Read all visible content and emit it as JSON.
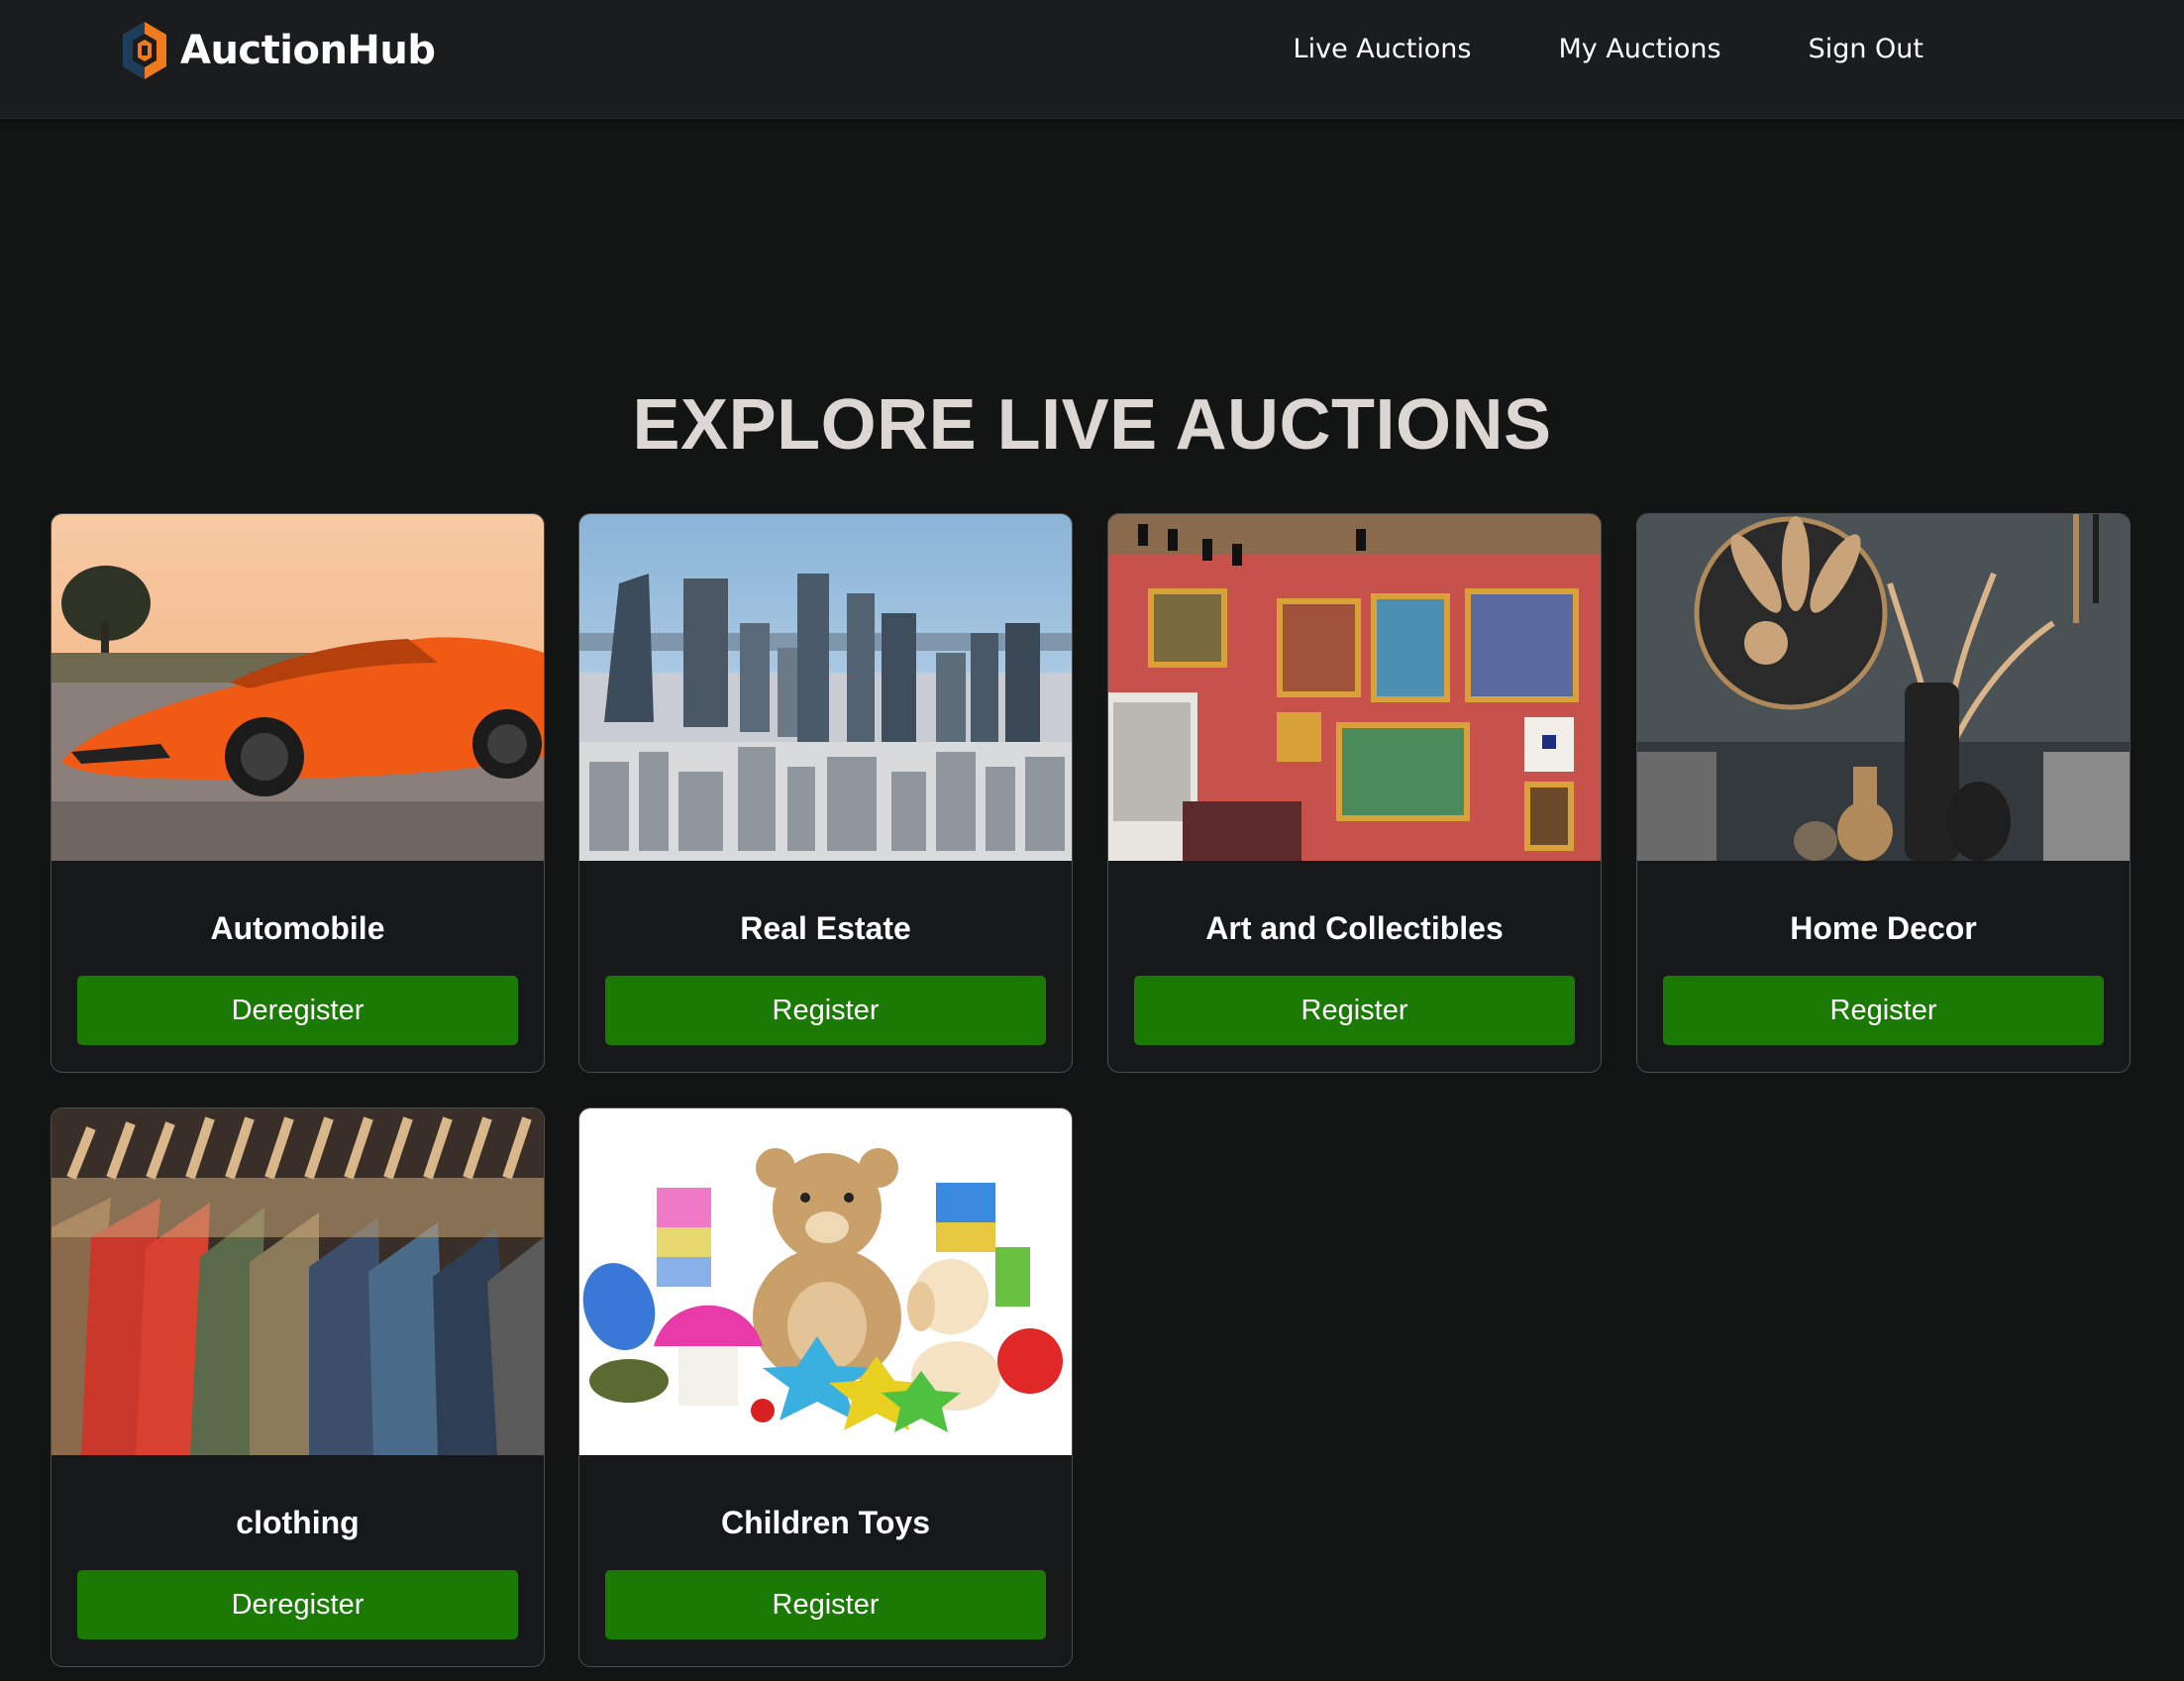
{
  "app": {
    "name": "AuctionHub"
  },
  "nav": {
    "links": [
      {
        "label": "Live Auctions"
      },
      {
        "label": "My Auctions"
      },
      {
        "label": "Sign Out"
      }
    ]
  },
  "main": {
    "title": "EXPLORE LIVE AUCTIONS",
    "cards": [
      {
        "title": "Automobile",
        "button": "Deregister",
        "image": "orange-sports-car-photo"
      },
      {
        "title": "Real Estate",
        "button": "Register",
        "image": "city-skyline-photo"
      },
      {
        "title": "Art and Collectibles",
        "button": "Register",
        "image": "art-gallery-photo"
      },
      {
        "title": "Home Decor",
        "button": "Register",
        "image": "home-decor-vases-photo"
      },
      {
        "title": "clothing",
        "button": "Deregister",
        "image": "clothing-rack-photo"
      },
      {
        "title": "Children Toys",
        "button": "Register",
        "image": "teddy-bear-toys-photo"
      }
    ]
  },
  "colors": {
    "background": "#131515",
    "navbar": "#1b1c1d",
    "button": "#1a7a03",
    "logo_orange": "#f07a1e",
    "logo_blue": "#1c3e5c"
  }
}
